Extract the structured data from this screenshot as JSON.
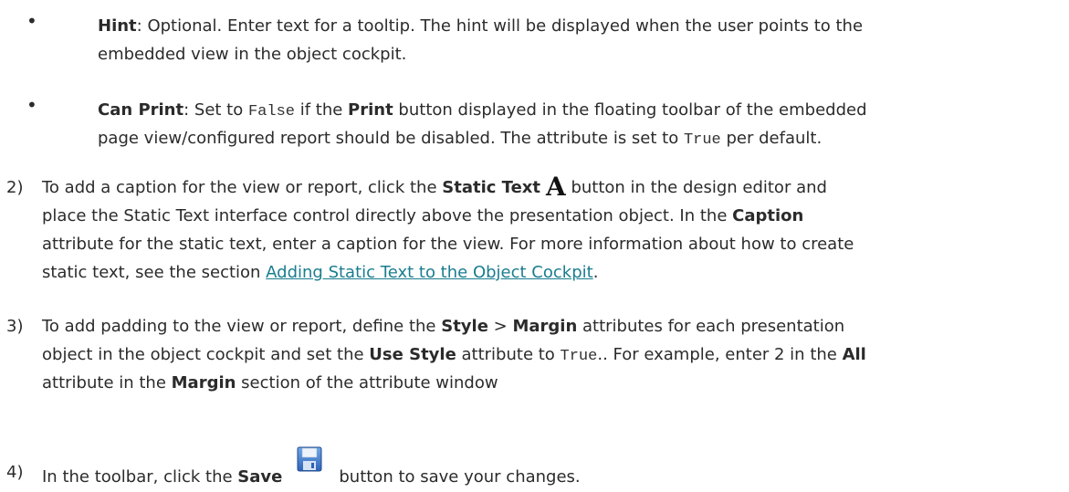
{
  "bullet_char": "•",
  "hint": {
    "term": "Hint",
    "text1": ": Optional. Enter text for a tooltip. The hint will be displayed when the user points to the",
    "text2": "embedded view in the object cockpit."
  },
  "can_print": {
    "term": "Can Print",
    "t1": ": Set to ",
    "code_false": "False",
    "t2": " if the ",
    "print_label": "Print",
    "t3": " button displayed in the floating toolbar of the embedded",
    "l2a": "page view/configured report should be disabled. The attribute is set to ",
    "code_true": "True",
    "l2b": " per default."
  },
  "step2": {
    "num": "2)",
    "l1a": "To add a caption for the view or report, click the ",
    "static_text": "Static Text",
    "icon_glyph": "A",
    "l1b": " button in the design editor and",
    "l2a": "place the Static Text interface control directly above the presentation object. In the ",
    "caption": "Caption",
    "l3": "attribute for the static text, enter a caption for the view. For more information about how to create",
    "l4a": "static text, see the section ",
    "link": "Adding Static Text to the Object Cockpit",
    "l4b": "."
  },
  "step3": {
    "num": "3)",
    "l1a": "To add padding to the view or report, define the ",
    "style": "Style",
    "sep": " > ",
    "margin": "Margin",
    "l1b": " attributes for each presentation",
    "l2a": "object in the object cockpit and set the ",
    "use_style": "Use Style",
    "l2b": " attribute to ",
    "code_true": "True",
    "l2c": ".. For example, enter 2 in the ",
    "all": "All",
    "l3a": "attribute in the ",
    "margin2": "Margin",
    "l3b": " section of the attribute window"
  },
  "step4": {
    "num": "4)",
    "l1a": "In the toolbar, click the ",
    "save": "Save",
    "l1b": "button to save your changes."
  },
  "icons": {
    "static_text": "static-text-A-icon",
    "save": "floppy-disk-save-icon"
  },
  "colors": {
    "text": "#2b2b2b",
    "link": "#1a7d8f"
  }
}
